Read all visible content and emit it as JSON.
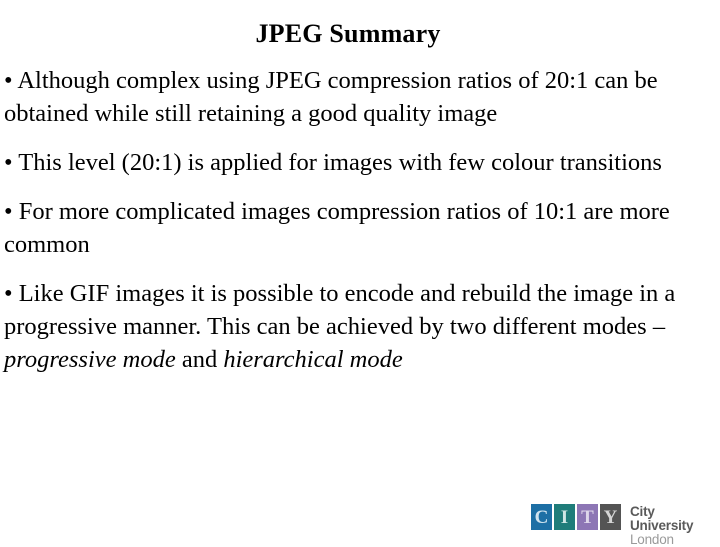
{
  "slide": {
    "title": "JPEG Summary",
    "background_color": "#ffffff",
    "text_color": "#000000",
    "bullets": [
      {
        "marker": "•",
        "text": "• Although complex using JPEG compression ratios of 20:1 can be obtained while still retaining a good quality image"
      },
      {
        "marker": "•",
        "text": "• This level (20:1) is applied for images with few colour transitions"
      },
      {
        "marker": "•",
        "text": "• For more complicated images compression ratios of 10:1 are more common"
      },
      {
        "marker": "•",
        "lead": "• Like GIF images it is possible to encode and rebuild the image in a progressive manner. This can be achieved by two different modes – ",
        "emphasis_1": "progressive mode",
        "conjunction": " and ",
        "emphasis_2": "hierarchical mode"
      }
    ]
  },
  "logo": {
    "squares": [
      {
        "letter": "C",
        "background": "#1d6fa5",
        "color": "#cfe3ef"
      },
      {
        "letter": "I",
        "background": "#1f7d7a",
        "color": "#cfe6e4"
      },
      {
        "letter": "T",
        "background": "#8d76b5",
        "color": "#ded6ea"
      },
      {
        "letter": "Y",
        "background": "#545454",
        "color": "#d5d5d5"
      }
    ],
    "wordmark_line1": "City University",
    "wordmark_line2": "London"
  }
}
